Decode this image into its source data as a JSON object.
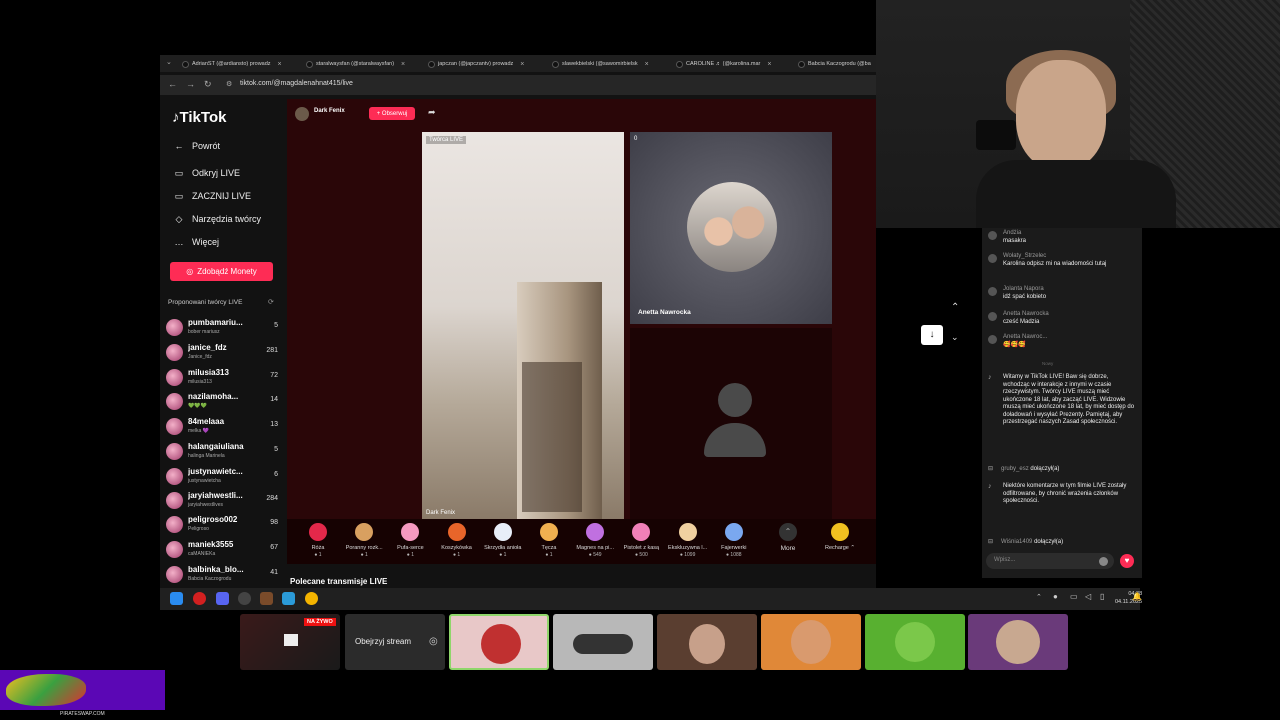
{
  "browser": {
    "tabs": [
      {
        "label": "AdrianST (@ardiansto) prowadz"
      },
      {
        "label": "staralwaysfan (@staralwaysfan)"
      },
      {
        "label": "japczan (@japczantv) prowadz"
      },
      {
        "label": "slawekbielski (@sawomirbielsk"
      },
      {
        "label": "CAROLINE ♬ (@karolina.mar"
      },
      {
        "label": "Babcia Kaczogrodu (@ba"
      }
    ],
    "url": "tiktok.com/@magdalenahnat415/live"
  },
  "tiktok": {
    "logo": "TikTok",
    "menu": [
      {
        "label": "Powrót",
        "icon": "back-arrow-icon"
      },
      {
        "label": "Odkryj LIVE",
        "icon": "live-icon"
      },
      {
        "label": "ZACZNIJ LIVE",
        "icon": "camera-icon"
      },
      {
        "label": "Narzędzia twórcy",
        "icon": "lightbulb-icon"
      },
      {
        "label": "Więcej",
        "icon": "more-icon"
      }
    ],
    "coins_button": "Zdobądź Monety",
    "suggested_title": "Proponowani twórcy LIVE",
    "creators": [
      {
        "name": "pumbamariu...",
        "sub": "bober mariusz",
        "count": "5"
      },
      {
        "name": "janice_fdz",
        "sub": "Janice_fdz",
        "count": "281"
      },
      {
        "name": "milusia313",
        "sub": "milusia313",
        "count": "72"
      },
      {
        "name": "nazilamoha...",
        "sub": "💚💚💚",
        "count": "14"
      },
      {
        "name": "84melaaa",
        "sub": "melka 💜",
        "count": "13"
      },
      {
        "name": "halangaiuliana",
        "sub": "halinga Marinela",
        "count": "5"
      },
      {
        "name": "justynawietc...",
        "sub": "justynawietcha",
        "count": "6"
      },
      {
        "name": "jaryiahwestli...",
        "sub": "jaryiahwestlives",
        "count": "284"
      },
      {
        "name": "peligroso002",
        "sub": "Peligroso",
        "count": "98"
      },
      {
        "name": "maniek3555",
        "sub": "caMANIEKa",
        "count": "67"
      },
      {
        "name": "balbinka_blo...",
        "sub": "Babcia Kaczogrodu",
        "count": "41"
      }
    ],
    "host_name": "Dark Fenix",
    "follow_button": "+ Obserwuj",
    "panel_a_badge": "Twórca LIVE",
    "panel_a_host": "Dark Fenix",
    "panel_b_count": "0",
    "guest_name": "Anetta Nawrocka",
    "gifts": [
      {
        "label": "Róża",
        "price": "1",
        "color": "#e4284a"
      },
      {
        "label": "Poranny rozk...",
        "price": "1",
        "color": "#d8a060"
      },
      {
        "label": "Pufa-serce",
        "price": "1",
        "color": "#f59ac0"
      },
      {
        "label": "Koszykówka",
        "price": "1",
        "color": "#e8652a"
      },
      {
        "label": "Skrzydła anioła",
        "price": "1",
        "color": "#e8eef8"
      },
      {
        "label": "Tęcza",
        "price": "1",
        "color": "#f0b050"
      },
      {
        "label": "Magnes na pi...",
        "price": "549",
        "color": "#c070e0"
      },
      {
        "label": "Pistolet z kasą",
        "price": "500",
        "color": "#f080b8"
      },
      {
        "label": "Ekskluzywna l...",
        "price": "1099",
        "color": "#f0d0a0"
      },
      {
        "label": "Fajerwerki",
        "price": "1088",
        "color": "#7aa8f0"
      }
    ],
    "more_label": "More",
    "recharge_label": "Recharge",
    "recommended_title": "Polecane transmisje LIVE"
  },
  "chat": {
    "messages": [
      {
        "name": "Andżia",
        "text": "masakra"
      },
      {
        "name": "Wołaty_Strzelec",
        "text": "Karolina odpisz mi na wiadomości tutaj"
      },
      {
        "name": "Jolanta Napora",
        "text": "idź spać kobieto"
      },
      {
        "name": "Anetta Nawrocka",
        "text": "cześć Madzia"
      },
      {
        "name": "Anetta Nawroc...",
        "text": "🥰🥰🥰"
      }
    ],
    "separator": "Nowy",
    "welcome": "Witamy w TikTok LIVE! Baw się dobrze, wchodząc w interakcje z innymi w czasie rzeczywistym. Twórcy LIVE muszą mieć ukończone 18 lat, aby zacząć LIVE. Widzowie muszą mieć ukończone 18 lat, by mieć dostęp do doładowań i wysyłać Prezenty. Pamiętaj, aby przestrzegać naszych Zasad społeczności.",
    "join1_name": "gruby_esz",
    "join1_action": "dołączył(a)",
    "filter_notice": "Niektóre komentarze w tym filmie LIVE zostały odfiltrowane, by chronić wrażenia członków społeczności.",
    "join2_name": "Wiśnia1409",
    "join2_action": "dołączył(a)",
    "input_placeholder": "Wpisz..."
  },
  "taskbar": {
    "time": "04:38",
    "date": "04.11.2025"
  },
  "streams": {
    "live_badge": "NA ŻYWO",
    "watch_label": "Obejrzyj stream"
  },
  "footer": {
    "site": "PIRATESWAP.COM"
  }
}
